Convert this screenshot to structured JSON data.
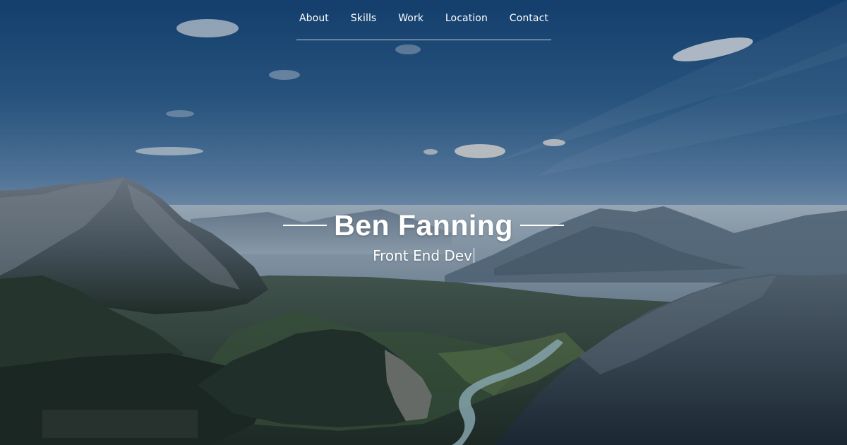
{
  "nav": {
    "items": [
      {
        "label": "About"
      },
      {
        "label": "Skills"
      },
      {
        "label": "Work"
      },
      {
        "label": "Location"
      },
      {
        "label": "Contact"
      }
    ]
  },
  "hero": {
    "name": "Ben Fanning",
    "subtitle": "Front End Dev",
    "background_icon": "mountain-landscape-photo"
  },
  "colors": {
    "text": "#ffffff",
    "sky_top": "#15477a",
    "haze": "#b8c8d4"
  }
}
